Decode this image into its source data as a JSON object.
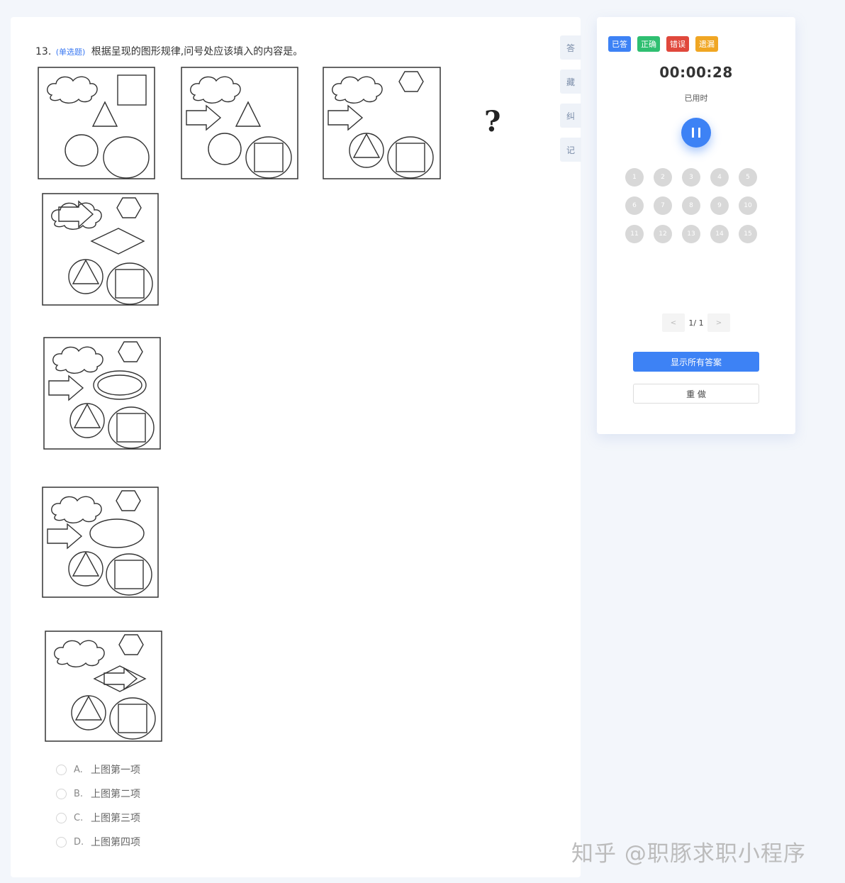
{
  "question": {
    "number": "13.",
    "type_tag": "(单选题)",
    "text": "根据呈现的图形规律,问号处应该填入的内容是。",
    "question_mark": "?"
  },
  "options": [
    {
      "key": "A.",
      "label": "上图第一项"
    },
    {
      "key": "B.",
      "label": "上图第二项"
    },
    {
      "key": "C.",
      "label": "上图第三项"
    },
    {
      "key": "D.",
      "label": "上图第四项"
    }
  ],
  "side_tabs": [
    "答",
    "藏",
    "纠",
    "记"
  ],
  "panel": {
    "legend": [
      {
        "label": "已答",
        "color": "#3d82f5"
      },
      {
        "label": "正确",
        "color": "#2fbf71"
      },
      {
        "label": "错误",
        "color": "#e0483c"
      },
      {
        "label": "遗漏",
        "color": "#f0a623"
      }
    ],
    "timer": "00:00:28",
    "timer_label": "已用时",
    "question_numbers": [
      "1",
      "2",
      "3",
      "4",
      "5",
      "6",
      "7",
      "8",
      "9",
      "10",
      "11",
      "12",
      "13",
      "14",
      "15"
    ],
    "pager": {
      "prev": "<",
      "text": "1/ 1",
      "next": ">"
    },
    "show_answers_label": "显示所有答案",
    "redo_label": "重 做"
  },
  "watermark": "知乎 @职豚求职小程序"
}
